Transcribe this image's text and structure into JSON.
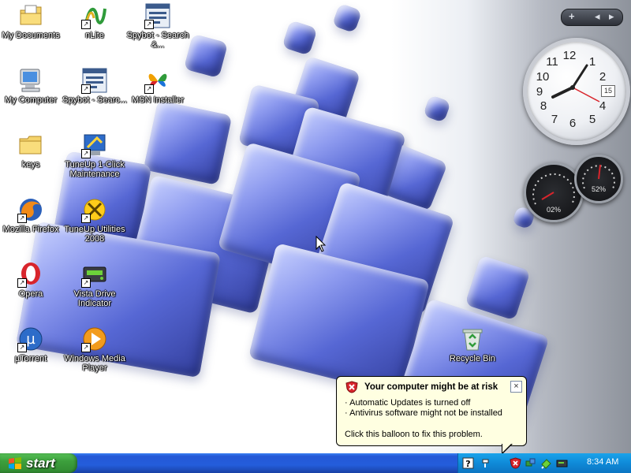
{
  "desktop": {
    "icons": [
      {
        "label": "My Documents",
        "icon": "my-documents-icon"
      },
      {
        "label": "nLite",
        "icon": "nlite-icon"
      },
      {
        "label": "Spybot - Search &...",
        "icon": "spybot-icon"
      },
      {
        "label": "My Computer",
        "icon": "my-computer-icon"
      },
      {
        "label": "Spybot - Searc...",
        "icon": "spybot-icon"
      },
      {
        "label": "MSN Installer",
        "icon": "msn-butterfly-icon"
      },
      {
        "label": "keys",
        "icon": "folder-icon"
      },
      {
        "label": "TuneUp 1-Click Maintenance",
        "icon": "tuneup-1click-icon"
      },
      {
        "label": "Mozilla Firefox",
        "icon": "firefox-icon"
      },
      {
        "label": "TuneUp Utilities 2008",
        "icon": "tuneup-utilities-icon"
      },
      {
        "label": "Opera",
        "icon": "opera-icon"
      },
      {
        "label": "Vista Drive Indicator",
        "icon": "vista-drive-indicator-icon"
      },
      {
        "label": "µTorrent",
        "icon": "utorrent-icon"
      },
      {
        "label": "Windows Media Player",
        "icon": "windows-media-player-icon"
      },
      {
        "label": "Recycle Bin",
        "icon": "recycle-bin-icon"
      }
    ]
  },
  "sidebar": {
    "controls": {
      "add": "+",
      "prev": "◂",
      "next": "▸"
    },
    "clock": {
      "numbers": [
        "12",
        "1",
        "2",
        "3",
        "4",
        "5",
        "6",
        "7",
        "8",
        "9",
        "10",
        "11"
      ],
      "date": "15",
      "time_shown": "8:34"
    },
    "cpu_meter": {
      "cpu_percent": "02%",
      "memory_percent": "52%"
    }
  },
  "balloon": {
    "title": "Your computer might be at risk",
    "close": "×",
    "lines": [
      "· Automatic Updates is turned off",
      "· Antivirus software might not be installed"
    ],
    "footer": "Click this balloon to fix this problem."
  },
  "taskbar": {
    "start_label": "start",
    "tray_time": "8:34 AM",
    "tray_icons": [
      "help-icon",
      "network-icon",
      "security-center-shield-icon",
      "ethernet-icon",
      "safely-remove-icon",
      "drive-icon"
    ]
  },
  "colors": {
    "cube_blue": "#5667d4",
    "taskbar_blue": "#245ddb",
    "start_green": "#3c9f3c",
    "tray_blue": "#0f8ad8",
    "balloon_bg": "#ffffe1",
    "shield_red": "#d8252c"
  }
}
